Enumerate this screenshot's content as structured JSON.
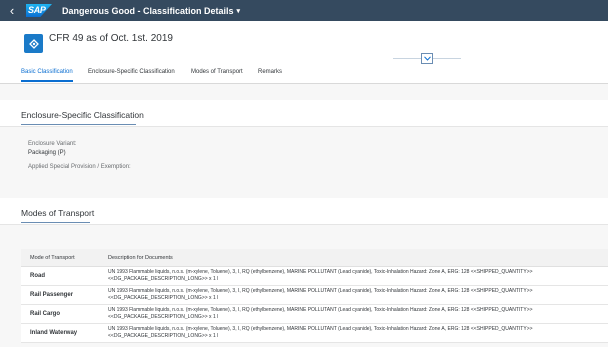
{
  "shell": {
    "logo_text": "SAP",
    "title": "Dangerous Good - Classification Details",
    "title_caret": "▾",
    "back_glyph": "‹"
  },
  "header": {
    "object_title": "CFR 49 as of Oct. 1st. 2019",
    "icon": "dangerous-good-icon"
  },
  "tabs": [
    {
      "label": "Basic Classification",
      "active": true
    },
    {
      "label": "Enclosure-Specific Classification",
      "active": false
    },
    {
      "label": "Modes of Transport",
      "active": false
    },
    {
      "label": "Remarks",
      "active": false
    }
  ],
  "enclosure": {
    "title": "Enclosure-Specific Classification",
    "variant_label": "Enclosure Variant:",
    "variant_value": "Packaging (P)",
    "provision_label": "Applied Special Provision / Exemption:"
  },
  "modes": {
    "title": "Modes of Transport",
    "columns": [
      "Mode of Transport",
      "Description for Documents"
    ],
    "rows": [
      {
        "mode": "Road",
        "description": "UN 1993 Flammable liquids, n.o.s. (m-xylene, Toluene), 3, I, RQ (ethylbenzene), MARINE POLLUTANT (Lead cyanide), Toxic-Inhalation Hazard: Zone A, ERG: 128 <<SHIPPED_QUANTITY>> <<DG_PACKAGE_DESCRIPTION_LONG>> x 1 l"
      },
      {
        "mode": "Rail Passenger",
        "description": "UN 1993 Flammable liquids, n.o.s. (m-xylene, Toluene), 3, I, RQ (ethylbenzene), MARINE POLLUTANT (Lead cyanide), Toxic-Inhalation Hazard: Zone A, ERG: 128 <<SHIPPED_QUANTITY>> <<DG_PACKAGE_DESCRIPTION_LONG>> x 1 l"
      },
      {
        "mode": "Rail Cargo",
        "description": "UN 1993 Flammable liquids, n.o.s. (m-xylene, Toluene), 3, I, RQ (ethylbenzene), MARINE POLLUTANT (Lead cyanide), Toxic-Inhalation Hazard: Zone A, ERG: 128 <<SHIPPED_QUANTITY>> <<DG_PACKAGE_DESCRIPTION_LONG>> x 1 l"
      },
      {
        "mode": "Inland Waterway",
        "description": "UN 1993 Flammable liquids, n.o.s. (m-xylene, Toluene), 3, I, RQ (ethylbenzene), MARINE POLLUTANT (Lead cyanide), Toxic-Inhalation Hazard: Zone A, ERG: 128 <<SHIPPED_QUANTITY>> <<DG_PACKAGE_DESCRIPTION_LONG>> x 1 l"
      }
    ]
  },
  "colors": {
    "shell": "#354a5f",
    "accent": "#0a6ed1",
    "background": "#f7f7f7"
  }
}
